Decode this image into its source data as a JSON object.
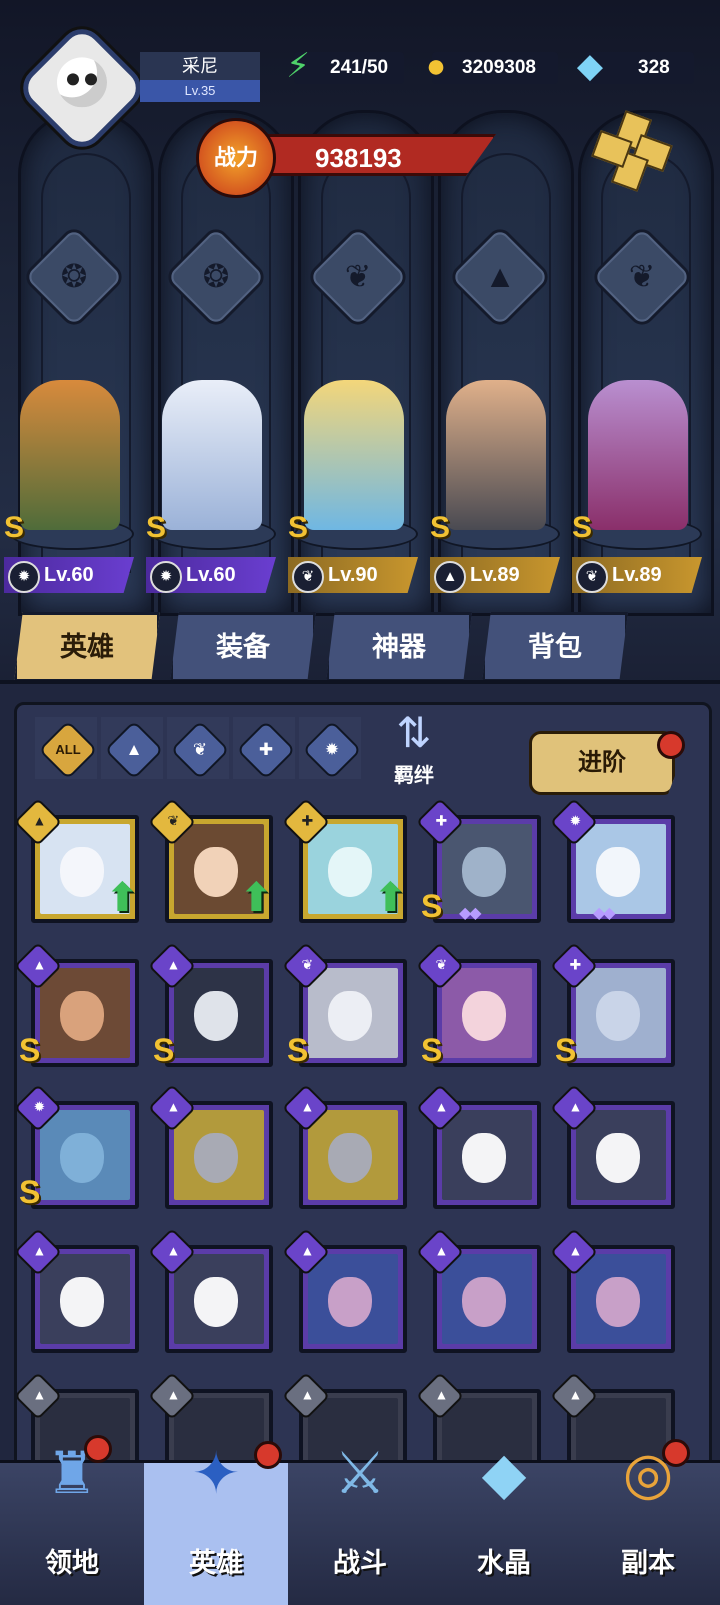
{
  "player": {
    "name": "采尼",
    "level": "Lv.35"
  },
  "resources": {
    "energy": "241/50",
    "gold": "3209308",
    "gems": "328"
  },
  "power": {
    "badge": "战力",
    "value": "938193"
  },
  "lineup": [
    {
      "level": "Lv.60",
      "rank": "S",
      "class": "beast"
    },
    {
      "level": "Lv.60",
      "rank": "S",
      "class": "beast"
    },
    {
      "level": "Lv.90",
      "rank": "S",
      "class": "wing"
    },
    {
      "level": "Lv.89",
      "rank": "S",
      "class": "mage"
    },
    {
      "level": "Lv.89",
      "rank": "S",
      "class": "wing"
    }
  ],
  "tabs": [
    "英雄",
    "装备",
    "神器",
    "背包"
  ],
  "filters": {
    "all": "ALL"
  },
  "bond_label": "羁绊",
  "advance_label": "进阶",
  "roster_ranks": {
    "row1": [
      "",
      "",
      "",
      "S",
      ""
    ],
    "row2": [
      "S",
      "S",
      "S",
      "S",
      "S"
    ],
    "row3": [
      "S",
      "",
      "",
      "",
      ""
    ]
  },
  "nav": [
    "领地",
    "英雄",
    "战斗",
    "水晶",
    "副本"
  ],
  "colors": {
    "accent_gold": "#e2c27c",
    "power_red": "#b12a22",
    "purple_card": "#5b3ca8",
    "gold_card": "#c8a72f"
  }
}
